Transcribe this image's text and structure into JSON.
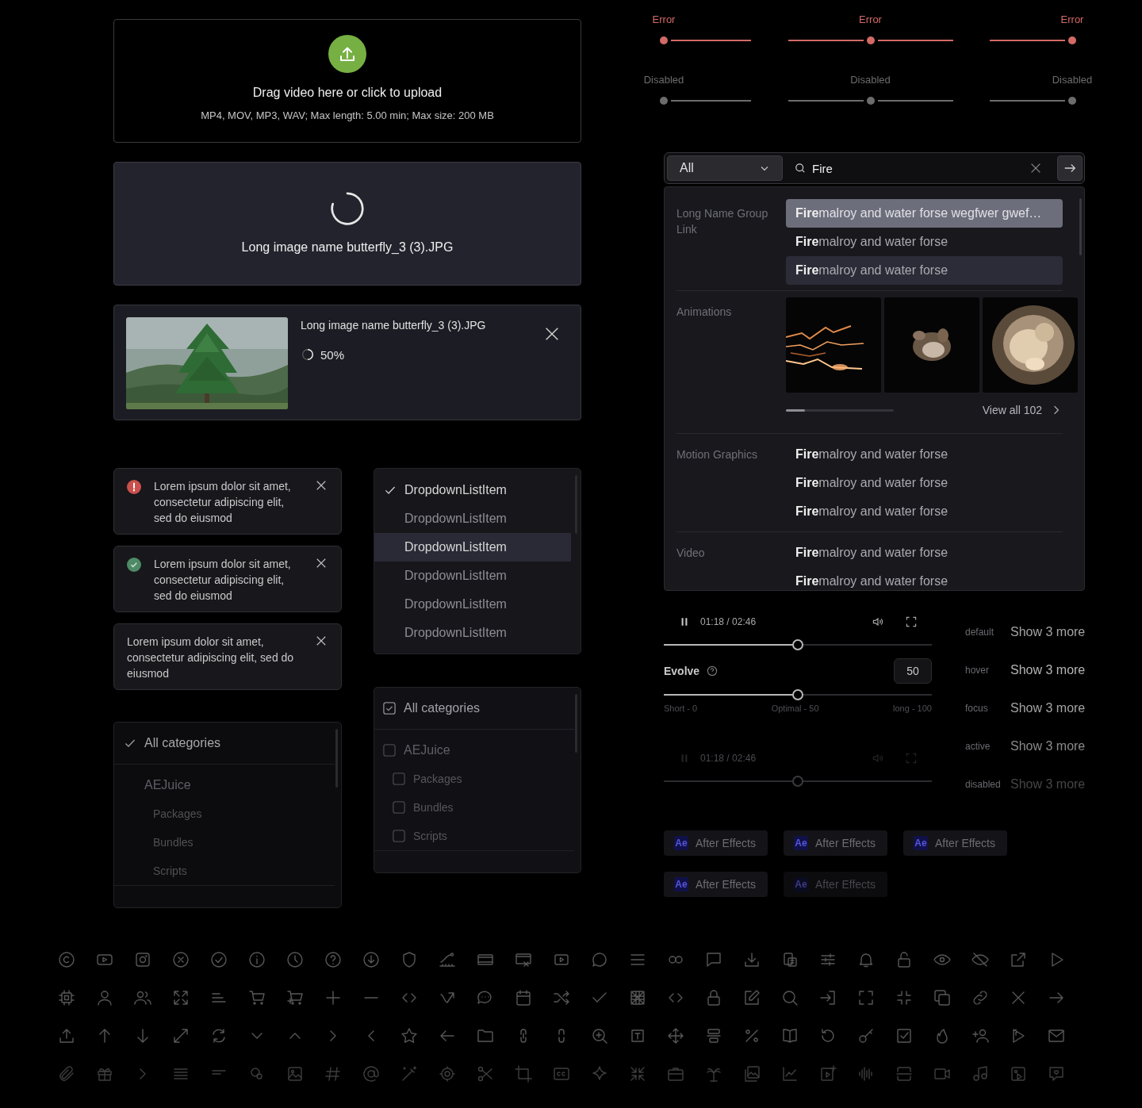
{
  "upload_dropzone": {
    "title": "Drag video here or click to upload",
    "hint": "MP4, MOV, MP3, WAV; Max length: 5.00 min; Max size: 200 MB"
  },
  "uploading_card": {
    "filename": "Long image name butterfly_3 (3).JPG"
  },
  "upload_progress_card": {
    "filename": "Long image name butterfly_3 (3).JPG",
    "progress": "50%",
    "level": 0.5
  },
  "alerts": [
    {
      "kind": "error",
      "text": "Lorem ipsum dolor sit amet, consectetur adipiscing elit, sed do eiusmod"
    },
    {
      "kind": "success",
      "text": "Lorem ipsum dolor sit amet, consectetur adipiscing elit, sed do eiusmod"
    },
    {
      "kind": "plain",
      "text": "Lorem ipsum dolor sit amet, consectetur adipiscing elit, sed do eiusmod"
    }
  ],
  "category_list": {
    "items": [
      {
        "label": "All categories",
        "checked": true
      },
      {
        "label": "AEJuice",
        "checked": false,
        "children": [
          {
            "label": "Packages",
            "checked": false
          },
          {
            "label": "Bundles",
            "checked": false
          },
          {
            "label": "Scripts",
            "checked": false
          }
        ]
      }
    ]
  },
  "dropdown_list": {
    "items": [
      {
        "label": "DropdownListItem",
        "checked": true,
        "highlighted": false
      },
      {
        "label": "DropdownListItem",
        "checked": false,
        "highlighted": false
      },
      {
        "label": "DropdownListItem",
        "checked": false,
        "highlighted": true
      },
      {
        "label": "DropdownListItem",
        "checked": false,
        "highlighted": false
      },
      {
        "label": "DropdownListItem",
        "checked": false,
        "highlighted": false
      },
      {
        "label": "DropdownListItem",
        "checked": false,
        "highlighted": false
      }
    ]
  },
  "checkbox_list": {
    "items": [
      {
        "label": "All categories",
        "checked": true
      },
      {
        "label": "AEJuice",
        "checked": false,
        "children": [
          {
            "label": "Packages",
            "checked": false
          },
          {
            "label": "Bundles",
            "checked": false
          },
          {
            "label": "Scripts",
            "checked": false
          }
        ]
      }
    ]
  },
  "slider_rows": [
    {
      "kind": "error",
      "sliders": [
        {
          "label": "Error",
          "level": 0
        },
        {
          "label": "Error",
          "level": 0.5
        },
        {
          "label": "Error",
          "level": 1
        }
      ]
    },
    {
      "kind": "disabled",
      "sliders": [
        {
          "label": "Disabled",
          "level": 0
        },
        {
          "label": "Disabled",
          "level": 0.5
        },
        {
          "label": "Disabled",
          "level": 1
        }
      ]
    }
  ],
  "search": {
    "category": "All",
    "query": "Fire",
    "groups": [
      {
        "name": "Long Name Group Link",
        "kind": "links",
        "items": [
          {
            "text": "**Fire**malroy and water forse wegfwer gwef…",
            "selected": true,
            "highlighted": false
          },
          {
            "text": "**Fire**malroy and water forse",
            "selected": false,
            "highlighted": false
          },
          {
            "text": "**Fire**malroy and water forse",
            "selected": false,
            "highlighted": true
          }
        ]
      },
      {
        "name": "Animations",
        "kind": "thumbnails",
        "view_all": "View all 102"
      },
      {
        "name": "Motion Graphics",
        "kind": "links",
        "items": [
          {
            "text": "**Fire**malroy and water forse",
            "selected": false,
            "highlighted": false
          },
          {
            "text": "**Fire**malroy and water forse",
            "selected": false,
            "highlighted": false
          },
          {
            "text": "**Fire**malroy and water forse",
            "selected": false,
            "highlighted": false
          }
        ]
      },
      {
        "name": "Video",
        "kind": "links",
        "items": [
          {
            "text": "**Fire**malroy and water forse",
            "selected": false,
            "highlighted": false
          },
          {
            "text": "**Fire**malroy and water forse",
            "selected": false,
            "highlighted": false
          }
        ]
      }
    ]
  },
  "players": [
    {
      "time": "01:18 / 02:46",
      "level": 0.5,
      "disabled": false
    },
    {
      "time": "01:18 / 02:46",
      "level": 0.5,
      "disabled": true
    }
  ],
  "evolve": {
    "label": "Evolve",
    "value": "50",
    "level": 0.5,
    "ticks": [
      "Short - 0",
      "Optimal - 50",
      "long - 100"
    ]
  },
  "link_states": [
    {
      "state": "default",
      "label": "Show 3 more"
    },
    {
      "state": "hover",
      "label": "Show 3 more"
    },
    {
      "state": "focus",
      "label": "Show 3 more"
    },
    {
      "state": "active",
      "label": "Show 3 more"
    },
    {
      "state": "disabled",
      "label": "Show 3 more"
    }
  ],
  "tags": [
    {
      "badge": "Ae",
      "label": "After Effects",
      "disabled": false
    },
    {
      "badge": "Ae",
      "label": "After Effects",
      "disabled": false
    },
    {
      "badge": "Ae",
      "label": "After Effects",
      "disabled": false
    },
    {
      "badge": "Ae",
      "label": "After Effects",
      "disabled": false
    },
    {
      "badge": "Ae",
      "label": "After Effects",
      "disabled": true
    }
  ]
}
